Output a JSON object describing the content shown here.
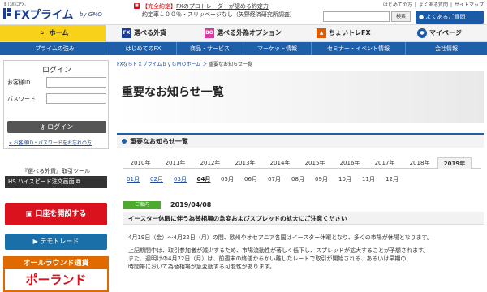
{
  "header": {
    "logo_tagline": "まじめにFX。",
    "logo_name": "FXプライム",
    "logo_by": "by GMO",
    "campaign_badge": "■",
    "campaign_line1_prefix": "【完全約定】",
    "campaign_line1_link": "FXのプロトレーダーが認める約定力",
    "campaign_line2": "約定率１００％・スリッページなし（矢野経済研究所調査）",
    "util_links": [
      "はじめての方",
      "よくある質問",
      "サイトマップ"
    ],
    "font_size_label": "文字サイズ",
    "font_sizes": [
      "小",
      "中",
      "大"
    ],
    "search_placeholder": "",
    "search_button": "検索",
    "faq_button": "よくあるご質問"
  },
  "nav1": [
    {
      "label": "ホーム",
      "icon": "home-icon",
      "icon_text": "⌂",
      "color": "#f8d21a"
    },
    {
      "label": "選べる外貨",
      "icon": "fx-icon",
      "icon_text": "FX",
      "color": "#1d3f8f"
    },
    {
      "label": "選べる外為オプション",
      "icon": "bo-icon",
      "icon_text": "BO",
      "color": "#d43ea0"
    },
    {
      "label": "ちょいトレFX",
      "icon": "choi-icon",
      "icon_text": "▲",
      "color": "#e05a00"
    },
    {
      "label": "マイページ",
      "icon": "user-icon",
      "icon_text": "●",
      "color": "#1a5aa6"
    }
  ],
  "nav2": [
    "プライムの強み",
    "はじめてのFX",
    "商品・サービス",
    "マーケット情報",
    "セミナー・イベント情報",
    "会社情報"
  ],
  "sidebar": {
    "login_title": "ログイン",
    "customer_id_label": "お客様ID",
    "password_label": "パスワード",
    "login_button": "ログイン",
    "forgot_link": "お客様ID・パスワードをお忘れの方",
    "tool_title": "『選べる外貨』取引ツール",
    "tool_button": "ハイスピード注文画面",
    "open_account_button": "口座を開設する",
    "demo_button": "デモトレード",
    "promo_line1": "オールラウンド通貨",
    "promo_line2": "ポーランド"
  },
  "main": {
    "breadcrumb_home": "FXならＦＸプライムｂｙＧＭＯホーム",
    "breadcrumb_sep": "＞",
    "breadcrumb_current": "重要なお知らせ一覧",
    "page_title": "重要なお知らせ一覧",
    "section_title": "重要なお知らせ一覧",
    "years": [
      "2010年",
      "2011年",
      "2012年",
      "2013年",
      "2014年",
      "2015年",
      "2016年",
      "2017年",
      "2018年",
      "2019年"
    ],
    "active_year": "2019年",
    "months": [
      "01月",
      "02月",
      "03月",
      "04月",
      "05月",
      "06月",
      "07月",
      "08月",
      "09月",
      "10月",
      "11月",
      "12月"
    ],
    "active_month": "04月",
    "notice": {
      "category": "ご案内",
      "date": "2019/04/08",
      "title": "イースター休暇に伴う為替相場の急変およびスプレッドの拡大にご注意ください",
      "body_lines": [
        "4月19日（金）～4月22日（月）の間、欧州やオセアニア各国はイースター休暇となり、多くの市場が休場となります。",
        "上記期間中は、取引参加者が減少するため、市場流動性が著しく低下し、スプレッドが拡大することが予想されます。",
        "また、週明けの4月22日（月）は、前週末の終値からかい離したレートで取引が開始される、あるいは早期の",
        "時間帯において為替相場が急変動する可能性があります。"
      ]
    }
  }
}
